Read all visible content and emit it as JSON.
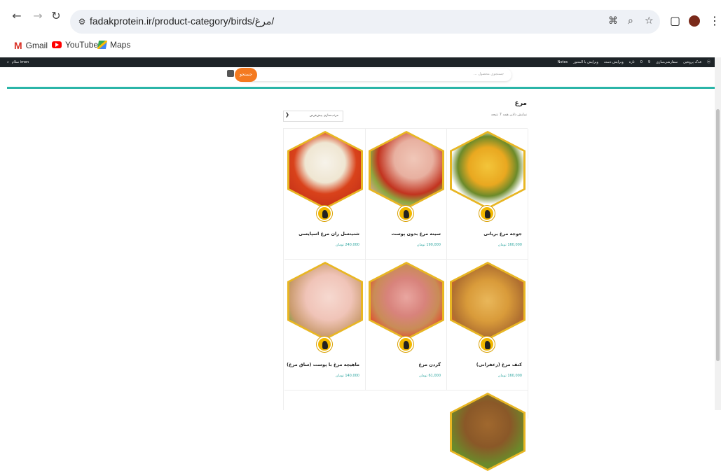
{
  "browser": {
    "url": "fadakprotein.ir/product-category/birds/مرغ/",
    "bookmarks": [
      {
        "label": "Gmail",
        "icon": "gmail-icon"
      },
      {
        "label": "YouTube",
        "icon": "youtube-icon"
      },
      {
        "label": "Maps",
        "icon": "maps-icon"
      }
    ]
  },
  "wpbar": {
    "left_items": [
      "سلام imen"
    ],
    "right_items": [
      "فدک پروتئین",
      "سفارشی‌سازی",
      "9",
      "0",
      "تازه",
      "ویرایش دسته",
      "ویرایش با المنتور",
      "Notes"
    ]
  },
  "site": {
    "search_placeholder": "جستجوی محصول ...",
    "search_button": "جستجو"
  },
  "category": {
    "title": "مرغ",
    "result_count": "نمایش دادن همه 7 نتیجه",
    "sort_label": "مرتب‌سازی پیش‌فرض"
  },
  "products": [
    {
      "name": "جوجه مرغ بریانی",
      "price": "160,000 تومان"
    },
    {
      "name": "سینه مرغ بدون پوست",
      "price": "190,000 تومان"
    },
    {
      "name": "شنیتسل ران مرغ اسپایسی",
      "price": "240,000 تومان"
    },
    {
      "name": "کتف مرغ (زعفرانی)",
      "price": "160,000 تومان"
    },
    {
      "name": "گردن مرغ",
      "price": "61,000 تومان"
    },
    {
      "name": "ماهیچه مرغ با پوست (ساق مرغ)",
      "price": "140,000 تومان"
    }
  ],
  "colors": {
    "accent_teal": "#2bb5a8",
    "search_orange": "#f47a20",
    "hex_border_gold": "#e8b623"
  }
}
